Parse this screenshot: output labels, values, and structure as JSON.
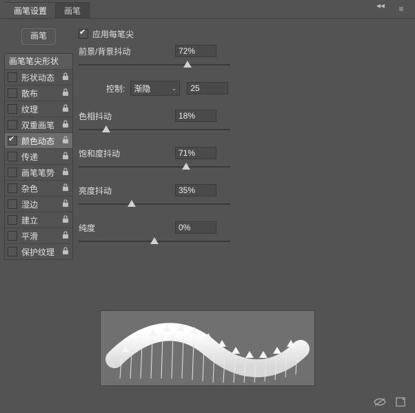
{
  "tabs": {
    "active": "画笔设置",
    "other": "画笔"
  },
  "left": {
    "brushButton": "画笔",
    "header": "画笔笔尖形状",
    "items": [
      {
        "label": "形状动态",
        "checked": false,
        "selected": false,
        "lock": true
      },
      {
        "label": "散布",
        "checked": false,
        "selected": false,
        "lock": true
      },
      {
        "label": "纹理",
        "checked": false,
        "selected": false,
        "lock": true
      },
      {
        "label": "双重画笔",
        "checked": false,
        "selected": false,
        "lock": true
      },
      {
        "label": "颜色动态",
        "checked": true,
        "selected": true,
        "lock": true
      },
      {
        "label": "传递",
        "checked": false,
        "selected": false,
        "lock": true
      },
      {
        "label": "画笔笔势",
        "checked": false,
        "selected": false,
        "lock": true
      },
      {
        "label": "杂色",
        "checked": false,
        "selected": false,
        "lock": true
      },
      {
        "label": "湿边",
        "checked": false,
        "selected": false,
        "lock": true
      },
      {
        "label": "建立",
        "checked": false,
        "selected": false,
        "lock": true
      },
      {
        "label": "平滑",
        "checked": false,
        "selected": false,
        "lock": true
      },
      {
        "label": "保护纹理",
        "checked": false,
        "selected": false,
        "lock": true
      }
    ]
  },
  "right": {
    "applyPerTip": {
      "label": "应用每笔尖",
      "checked": true
    },
    "fgbgJitter": {
      "label": "前景/背景抖动",
      "value": "72%",
      "percent": 72
    },
    "control": {
      "label": "控制:",
      "selected": "渐隐",
      "num": "25"
    },
    "hueJitter": {
      "label": "色相抖动",
      "value": "18%",
      "percent": 18
    },
    "satJitter": {
      "label": "饱和度抖动",
      "value": "71%",
      "percent": 71
    },
    "briJitter": {
      "label": "亮度抖动",
      "value": "35%",
      "percent": 35
    },
    "purity": {
      "label": "纯度",
      "value": "0%",
      "percent": 50
    }
  },
  "icons": {
    "lock": "🔒"
  }
}
